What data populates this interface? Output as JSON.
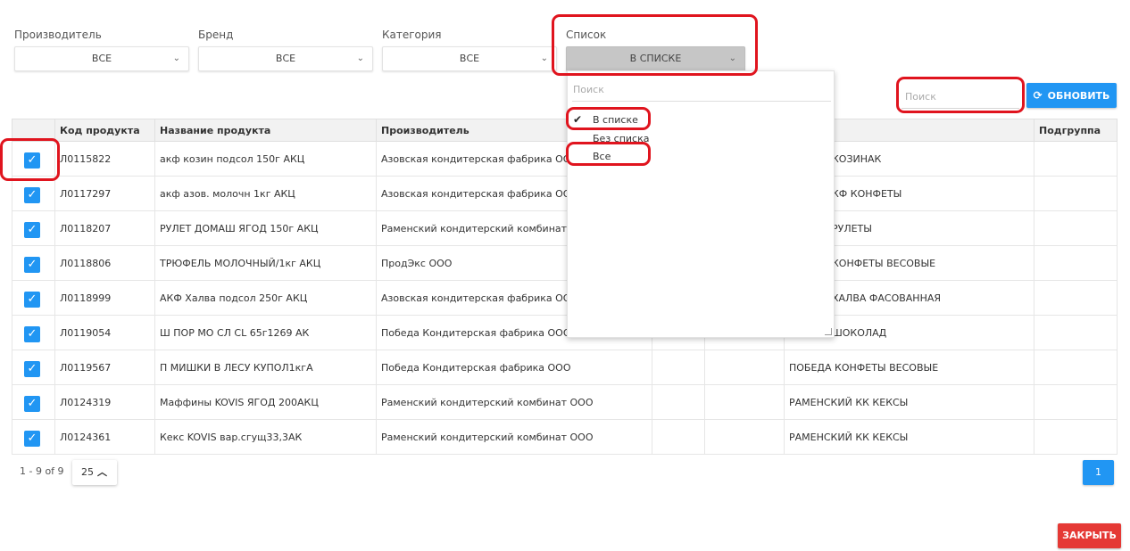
{
  "filters": [
    {
      "label": "Производитель",
      "value": "ВСЕ"
    },
    {
      "label": "Бренд",
      "value": "ВСЕ"
    },
    {
      "label": "Категория",
      "value": "ВСЕ"
    },
    {
      "label": "Список",
      "value": "В СПИСКЕ"
    }
  ],
  "search": {
    "placeholder": "Поиск"
  },
  "refresh_button": "ОБНОВИТЬ",
  "table": {
    "headers": [
      "",
      "Код продукта",
      "Название продукта",
      "Производитель",
      "",
      "",
      "",
      "Подгруппа"
    ],
    "rows": [
      {
        "code": "Л0115822",
        "name": "акф козин подсол 150г АКЦ",
        "maker": "Азовская кондитерская фабрика ООО",
        "group": "КОЗИНАК"
      },
      {
        "code": "Л0117297",
        "name": "акф азов. молочн 1кг АКЦ",
        "maker": "Азовская кондитерская фабрика ООО",
        "group": "КФ КОНФЕТЫ"
      },
      {
        "code": "Л0118207",
        "name": "РУЛЕТ ДОМАШ ЯГОД 150г АКЦ",
        "maker": "Раменский кондитерский комбинат ООО",
        "group": "РУЛЕТЫ"
      },
      {
        "code": "Л0118806",
        "name": "ТРЮФЕЛЬ МОЛОЧНЫЙ/1кг АКЦ",
        "maker": "ПродЭкс ООО",
        "group": "КОНФЕТЫ ВЕСОВЫЕ"
      },
      {
        "code": "Л0118999",
        "name": "АКФ Халва подсол 250г АКЦ",
        "maker": "Азовская кондитерская фабрика ООО",
        "group": "ХАЛВА ФАСОВАННАЯ"
      },
      {
        "code": "Л0119054",
        "name": "Ш ПОР МО СЛ CL 65г1269 АК",
        "maker": "Победа Кондитерская фабрика ООО",
        "group": "ШОКОЛАД"
      },
      {
        "code": "Л0119567",
        "name": "П МИШКИ В ЛЕСУ КУПОЛ1кгА",
        "maker": "Победа Кондитерская фабрика ООО",
        "group": "ПОБЕДА КОНФЕТЫ ВЕСОВЫЕ"
      },
      {
        "code": "Л0124319",
        "name": "Маффины KOVIS ЯГОД 200АКЦ",
        "maker": "Раменский кондитерский комбинат ООО",
        "group": "РАМЕНСКИЙ КК КЕКСЫ"
      },
      {
        "code": "Л0124361",
        "name": "Кекс KOVIS вар.сгущ33,3АК",
        "maker": "Раменский кондитерский комбинат ООО",
        "group": "РАМЕНСКИЙ КК КЕКСЫ"
      }
    ]
  },
  "pager": {
    "info": "1 - 9 of 9",
    "page_size": "25",
    "current_page": "1"
  },
  "close_button": "ЗАКРЫТЬ",
  "dropdown": {
    "search_placeholder": "Поиск",
    "options": [
      "В списке",
      "Без списка",
      "Все"
    ],
    "selected": "В списке"
  },
  "colors": {
    "primary": "#2196f3",
    "danger": "#e53935",
    "highlight": "#e0141e"
  }
}
